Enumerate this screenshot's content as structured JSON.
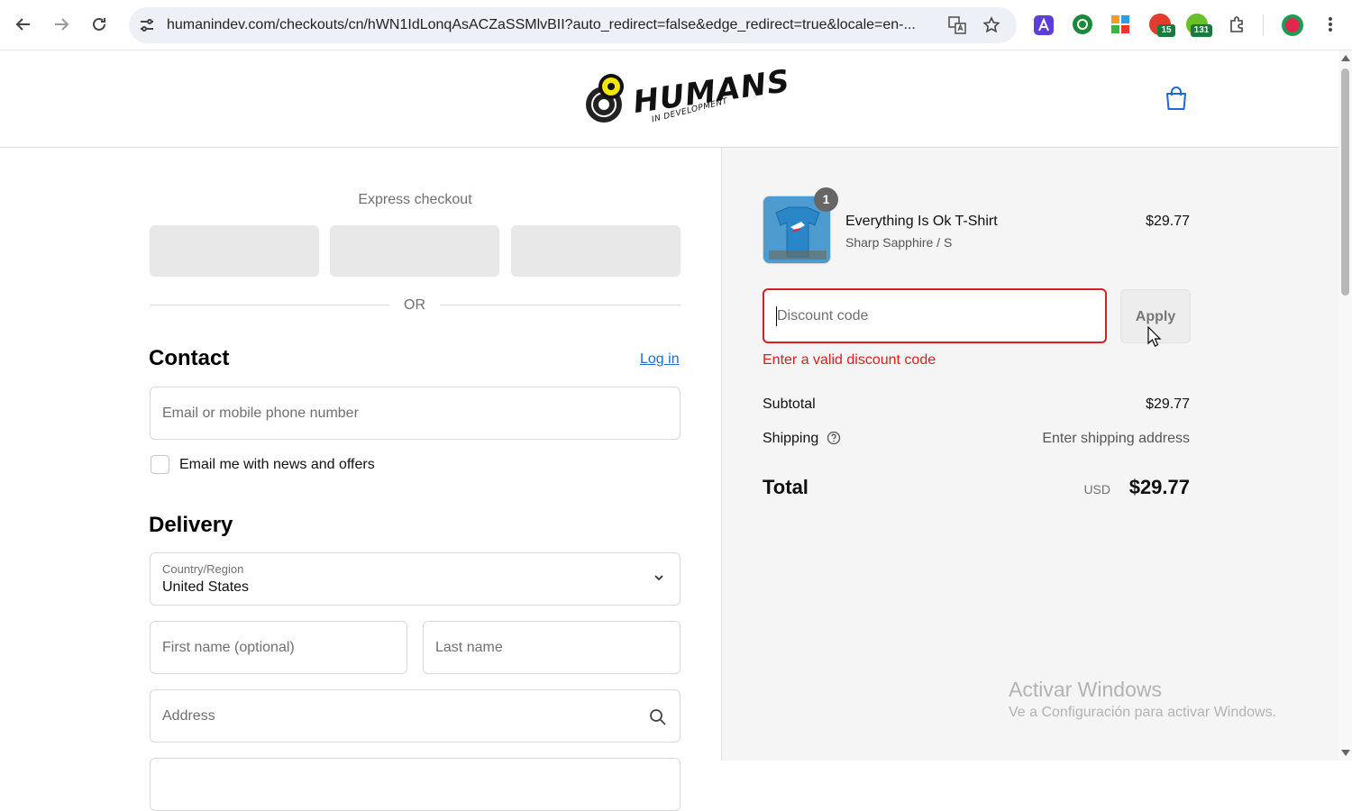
{
  "browser": {
    "url": "humanindev.com/checkouts/cn/hWN1IdLonqAsACZaSSMlvBII?auto_redirect=false&edge_redirect=true&locale=en-...",
    "extensions": [
      {
        "name": "a-extension-icon",
        "color": "#5b3fd6",
        "badge": ""
      },
      {
        "name": "green-circle-extension-icon",
        "color": "#1c8a3a",
        "badge": ""
      },
      {
        "name": "grid-extension-icon",
        "color": "#f0a020",
        "badge": ""
      },
      {
        "name": "red-extension-icon",
        "color": "#e33b2e",
        "badge": "15"
      },
      {
        "name": "green-lock-extension-icon",
        "color": "#6bbf2a",
        "badge": "131"
      }
    ]
  },
  "header": {
    "logo_text": "HUMANS",
    "logo_subtext": "IN DEVELOPMENT"
  },
  "checkout": {
    "express_label": "Express checkout",
    "or_label": "OR",
    "contact_title": "Contact",
    "login_label": "Log in",
    "email_placeholder": "Email or mobile phone number",
    "newsletter_label": "Email me with news and offers",
    "delivery_title": "Delivery",
    "country_label": "Country/Region",
    "country_value": "United States",
    "first_name_placeholder": "First name (optional)",
    "last_name_placeholder": "Last name",
    "address_placeholder": "Address"
  },
  "summary": {
    "product": {
      "name": "Everything Is Ok T-Shirt",
      "variant": "Sharp Sapphire / S",
      "price": "$29.77",
      "quantity": "1"
    },
    "discount_placeholder": "Discount code",
    "apply_label": "Apply",
    "discount_error": "Enter a valid discount code",
    "subtotal_label": "Subtotal",
    "subtotal_value": "$29.77",
    "shipping_label": "Shipping",
    "shipping_value": "Enter shipping address",
    "total_label": "Total",
    "currency": "USD",
    "total_value": "$29.77"
  },
  "watermark": {
    "line1": "Activar Windows",
    "line2": "Ve a Configuración para activar Windows."
  },
  "colors": {
    "link": "#1f6ad8",
    "error": "#dd1d1d",
    "summary_bg": "#f5f5f5"
  }
}
